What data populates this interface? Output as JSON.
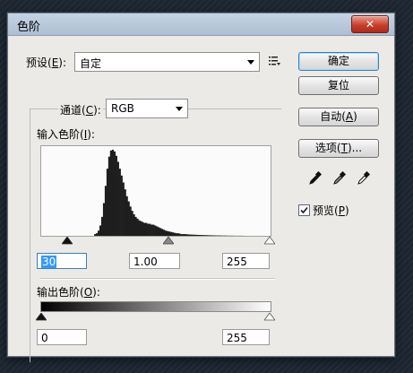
{
  "window": {
    "title": "色阶",
    "close_symbol": "✕"
  },
  "preset": {
    "label_pre": "预设(",
    "label_key": "E",
    "label_post": "):",
    "value": "自定"
  },
  "channel": {
    "label_pre": "通道(",
    "label_key": "C",
    "label_post": "):",
    "value": "RGB"
  },
  "input_levels": {
    "label_pre": "输入色阶(",
    "label_key": "I",
    "label_post": "):",
    "black": "30",
    "gamma": "1.00",
    "white": "255"
  },
  "output_levels": {
    "label_pre": "输出色阶(",
    "label_key": "O",
    "label_post": "):",
    "black": "0",
    "white": "255"
  },
  "buttons": {
    "ok": "确定",
    "reset": "复位",
    "auto_pre": "自动(",
    "auto_key": "A",
    "auto_post": ")",
    "options_pre": "选项(",
    "options_key": "T",
    "options_post": ")..."
  },
  "preview": {
    "label_pre": "预览(",
    "label_key": "P",
    "label_post": ")",
    "checked": true
  },
  "icons": {
    "preset_menu": "preset-options-menu-icon",
    "black_eyedropper": "black-point-eyedropper-icon",
    "gray_eyedropper": "gray-point-eyedropper-icon",
    "white_eyedropper": "white-point-eyedropper-icon"
  },
  "histogram": {
    "levels": [
      0,
      0,
      0,
      0,
      0,
      0,
      0,
      0,
      0,
      0,
      0,
      0,
      0,
      0,
      0,
      0,
      0,
      0,
      0,
      0,
      0,
      0,
      0,
      0,
      0,
      0,
      0,
      0,
      0,
      0,
      0.02,
      0.03,
      0.06,
      0.12,
      0.22,
      0.38,
      0.58,
      0.78,
      0.92,
      0.99,
      1.0,
      0.98,
      0.93,
      0.86,
      0.78,
      0.7,
      0.62,
      0.54,
      0.46,
      0.4,
      0.34,
      0.29,
      0.25,
      0.22,
      0.2,
      0.18,
      0.17,
      0.16,
      0.15,
      0.15,
      0.14,
      0.14,
      0.13,
      0.13,
      0.12,
      0.11,
      0.1,
      0.09,
      0.08,
      0.07,
      0.06,
      0.055,
      0.05,
      0.045,
      0.04,
      0.035,
      0.03,
      0.03,
      0.025,
      0.02,
      0.02,
      0.02,
      0.018,
      0.016,
      0.015,
      0.014,
      0.013,
      0.012,
      0.011,
      0.01,
      0.01,
      0.009,
      0.008,
      0.008,
      0.007,
      0.006,
      0.006,
      0.005,
      0.005,
      0.004,
      0.004,
      0.004,
      0.003,
      0.003,
      0.003,
      0.002,
      0.002,
      0.002,
      0.002,
      0.001,
      0.001,
      0.001,
      0.001,
      0.001,
      0.001,
      0.0,
      0.0,
      0.0,
      0.0,
      0.0,
      0.0,
      0.0,
      0.0,
      0.0,
      0.0,
      0.0,
      0.0,
      0.0,
      0.0,
      0.0
    ],
    "color": "#1e1e1e"
  },
  "colors": {
    "dialog_bg": "#eceae6",
    "title_bar": "#b8c8dc",
    "selection": "#3399ff"
  }
}
